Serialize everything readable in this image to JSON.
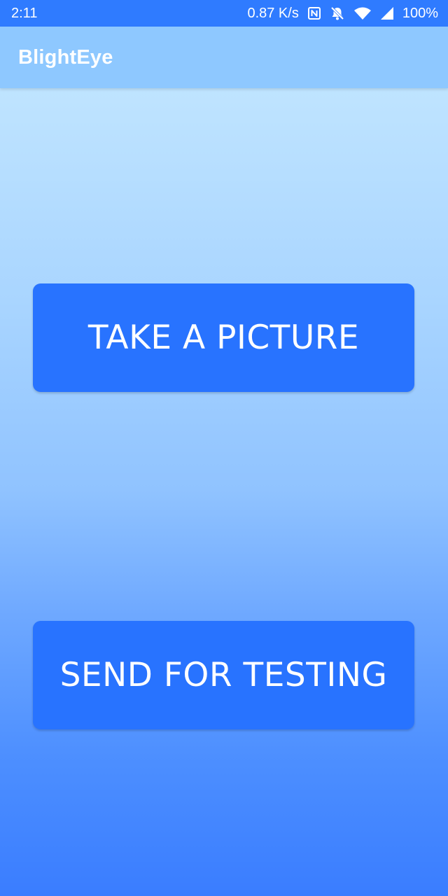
{
  "status_bar": {
    "time": "2:11",
    "network_speed": "0.87 K/s",
    "battery": "100%",
    "icons": [
      "nfc-icon",
      "notifications-off-icon",
      "wifi-icon",
      "cell-signal-icon"
    ]
  },
  "app_bar": {
    "title": "BlightEye",
    "color": "#8ec8ff"
  },
  "main": {
    "take_picture_label": "TAKE A PICTURE",
    "send_for_testing_label": "SEND FOR TESTING",
    "button_color": "#2873ff"
  },
  "colors": {
    "status_bar": "#2f7bff",
    "background_top": "#c4e8ff",
    "background_bottom": "#3a7dff"
  }
}
